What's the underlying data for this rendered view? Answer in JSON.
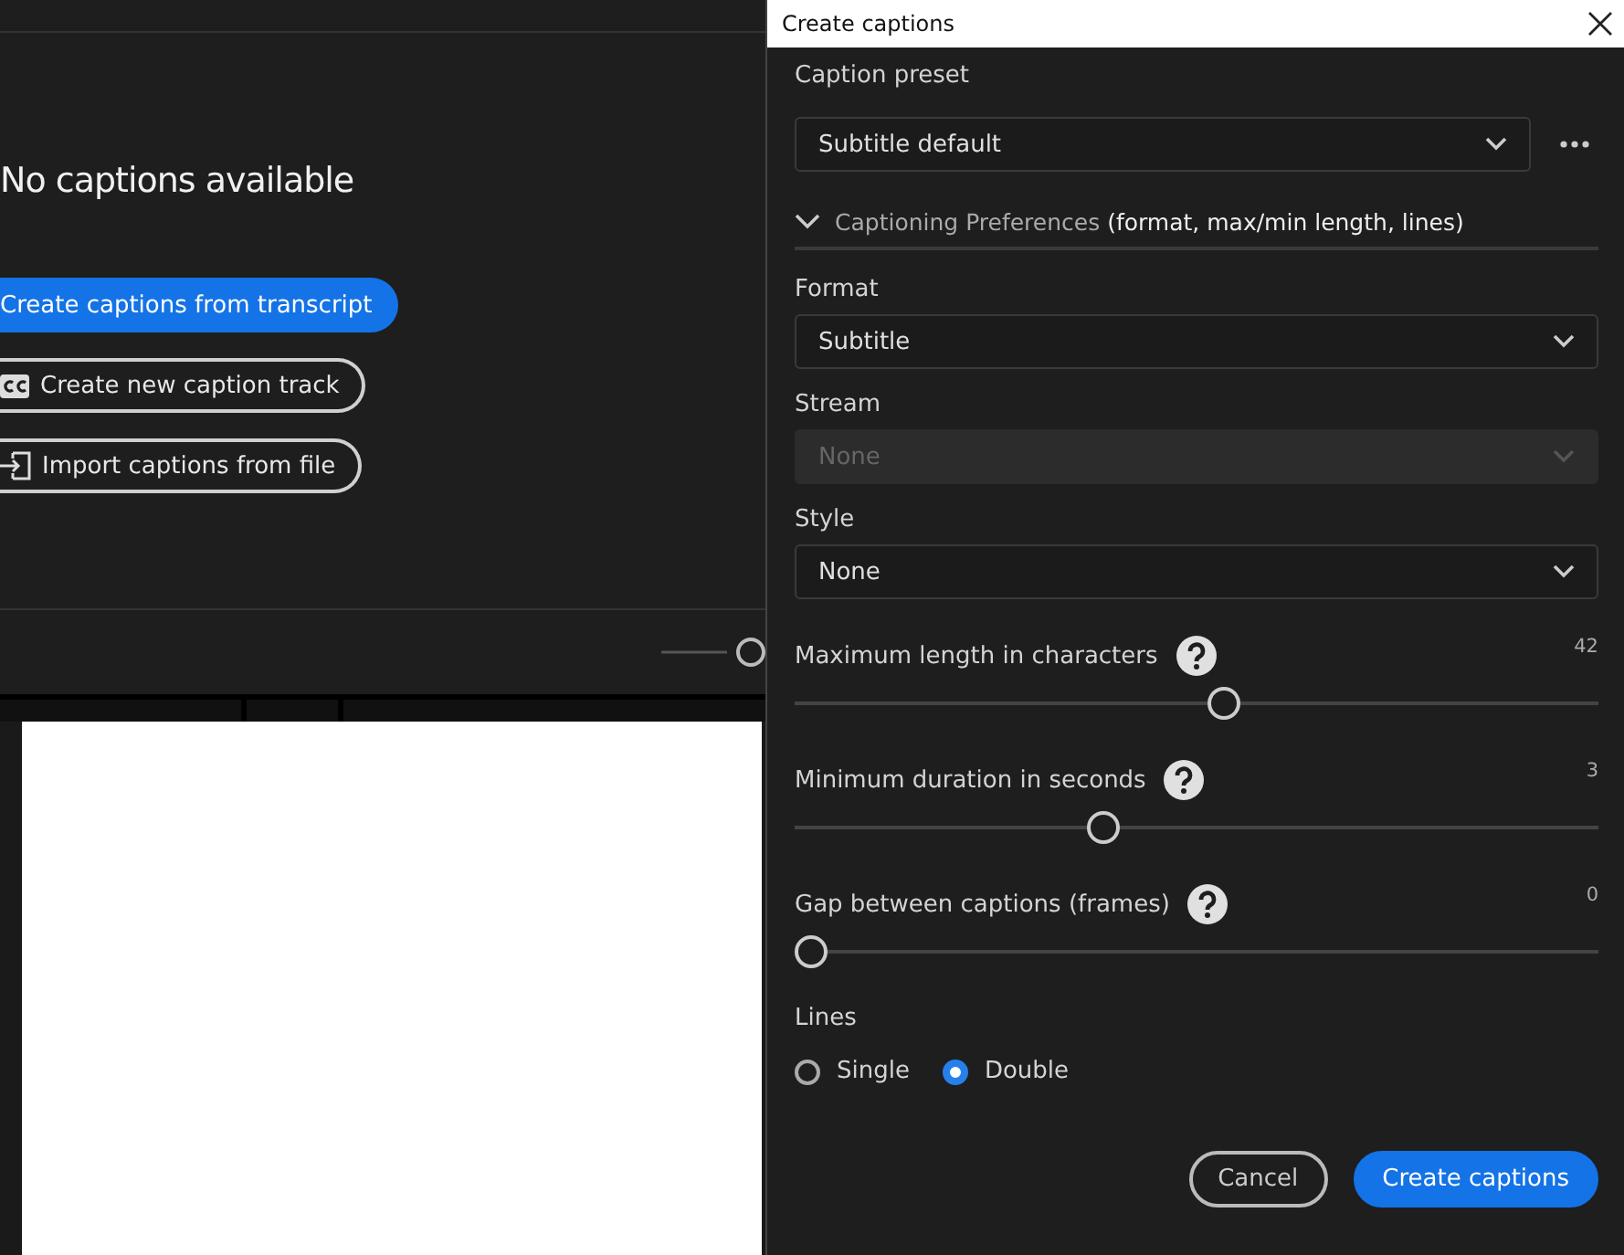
{
  "captions_panel": {
    "message": "No captions available",
    "actions": [
      {
        "label": "Create captions from transcript",
        "kind": "primary"
      },
      {
        "label": "Create new caption track",
        "kind": "cc"
      },
      {
        "label": "Import captions from file",
        "kind": "import"
      }
    ]
  },
  "dialog": {
    "title": "Create captions",
    "preset": {
      "label": "Caption preset",
      "value": "Subtitle default"
    },
    "preferences": {
      "title": "Captioning Preferences",
      "detail": "(format, max/min length, lines)",
      "expanded": true
    },
    "dropdowns": [
      {
        "label": "Format",
        "value": "Subtitle",
        "disabled": false
      },
      {
        "label": "Stream",
        "value": "None",
        "disabled": true
      },
      {
        "label": "Style",
        "value": "None",
        "disabled": false
      }
    ],
    "sliders": [
      {
        "label": "Maximum length in characters",
        "reading": "42",
        "level": 0.536
      },
      {
        "label": "Minimum duration in seconds",
        "reading": "3",
        "level": 0.38
      },
      {
        "label": "Gap between captions (frames)",
        "reading": "0",
        "level": 0
      }
    ],
    "lines": {
      "label": "Lines",
      "options": [
        {
          "label": "Single",
          "selected": false
        },
        {
          "label": "Double",
          "selected": true
        }
      ]
    },
    "buttons": [
      {
        "label": "Cancel",
        "kind": "secondary"
      },
      {
        "label": "Create captions",
        "kind": "primary"
      }
    ]
  }
}
